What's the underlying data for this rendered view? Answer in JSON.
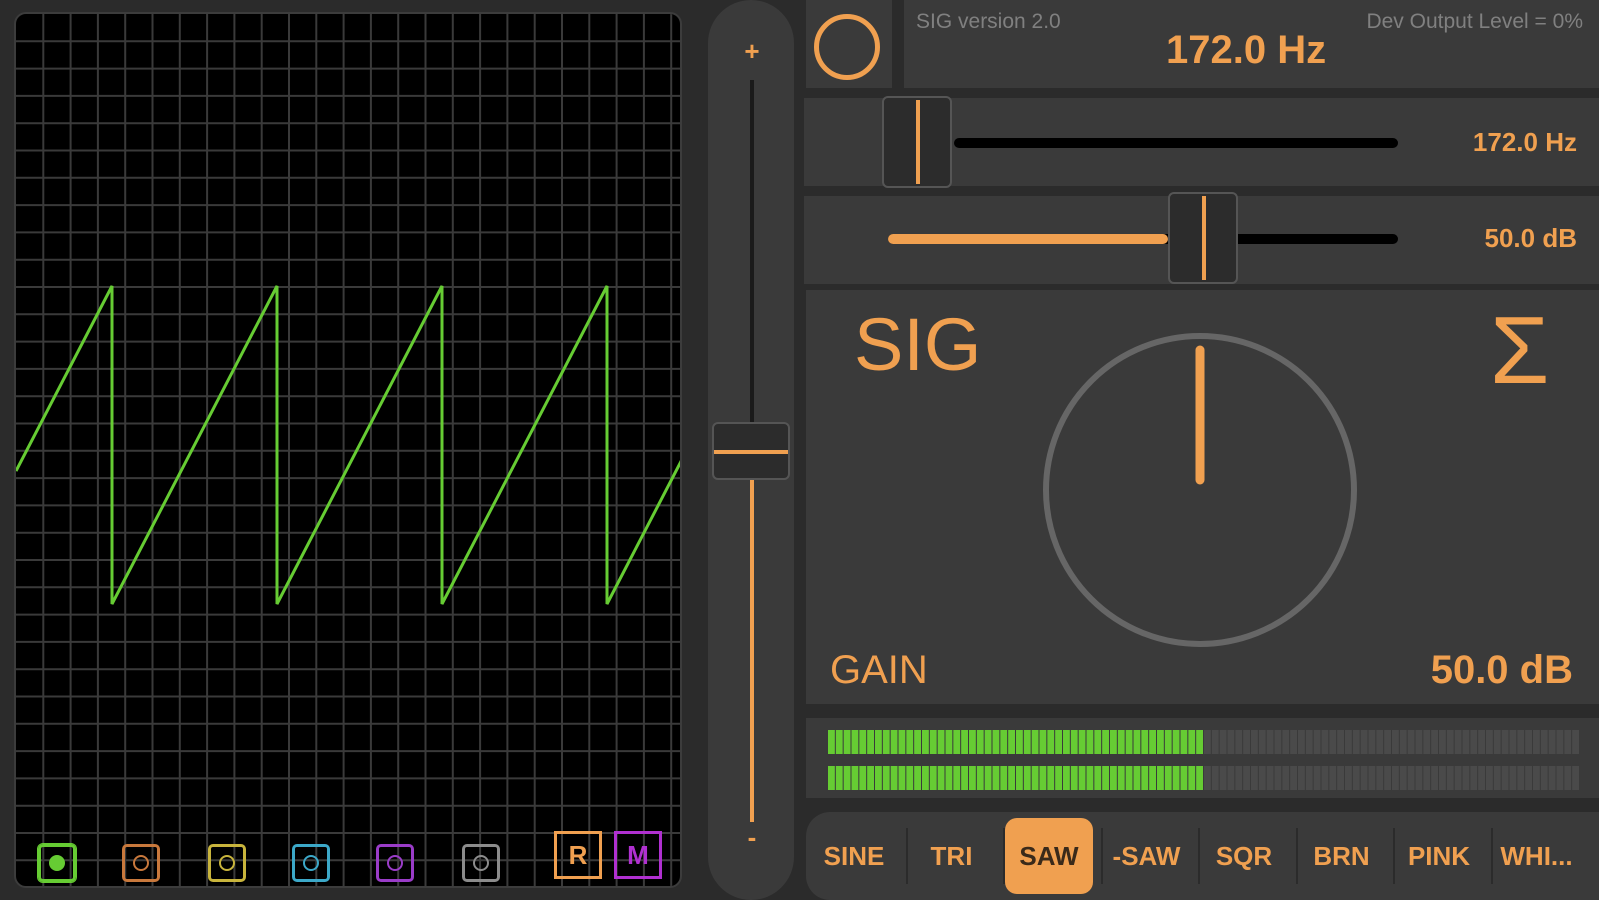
{
  "colors": {
    "accent": "#f0a050",
    "trace": "#66cc33",
    "grid": "#3a3a3a",
    "panel": "#3a3a3a",
    "background": "#2b2b2b",
    "meter_on": "#66cc33"
  },
  "header": {
    "version": "SIG version 2.0",
    "device_output": "Dev Output Level = 0%",
    "frequency_display": "172.0 Hz"
  },
  "power_button": {
    "icon": "power-ring-icon"
  },
  "output_slider": {
    "plus_label": "+",
    "minus_label": "-",
    "level": 0.5
  },
  "frequency_slider": {
    "value_label": "172.0 Hz",
    "position": 0.0
  },
  "gain_slider": {
    "value_label": "50.0 dB",
    "position": 0.5
  },
  "main_panel": {
    "title": "SIG",
    "sum_symbol": "Σ",
    "gain_label": "GAIN",
    "gain_value": "50.0 dB",
    "knob_angle_deg": 0
  },
  "meters": {
    "levels": [
      0.5,
      0.5
    ]
  },
  "scope": {
    "channels": [
      {
        "name": "channel-1",
        "color": "#66cc33",
        "active": true
      },
      {
        "name": "channel-2",
        "color": "#c8783c",
        "active": false
      },
      {
        "name": "channel-3",
        "color": "#c8b43c",
        "active": false
      },
      {
        "name": "channel-4",
        "color": "#3ca8c8",
        "active": false
      },
      {
        "name": "channel-5",
        "color": "#9a3cc8",
        "active": false
      },
      {
        "name": "channel-6",
        "color": "#8c8c8c",
        "active": false
      }
    ],
    "r_button": "R",
    "m_button": "M"
  },
  "waveforms": {
    "items": [
      "SINE",
      "TRI",
      "SAW",
      "-SAW",
      "SQR",
      "BRN",
      "PINK",
      "WHI..."
    ],
    "selected": "SAW"
  }
}
